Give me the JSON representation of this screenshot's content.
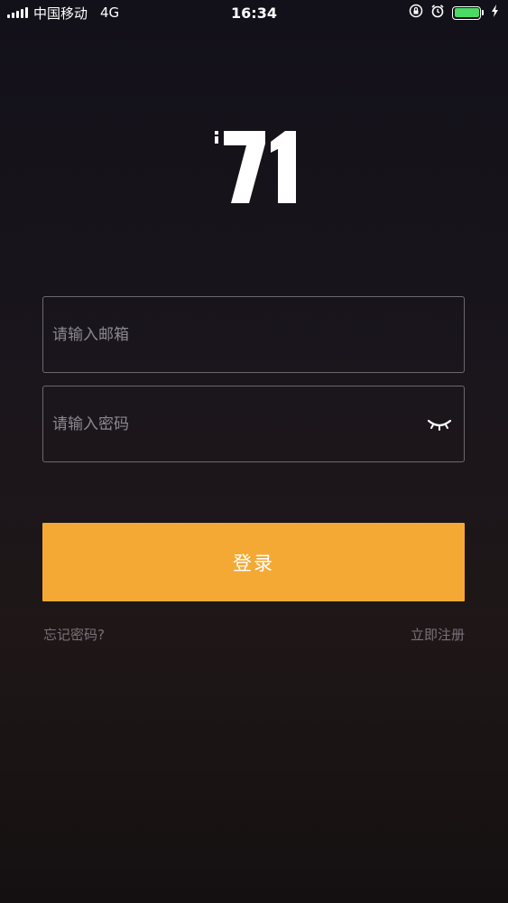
{
  "status_bar": {
    "carrier": "中国移动",
    "network": "4G",
    "time": "16:34"
  },
  "logo": {
    "text": "71",
    "small_mark": "i"
  },
  "login_form": {
    "email_placeholder": "请输入邮箱",
    "email_value": "",
    "password_placeholder": "请输入密码",
    "password_value": "",
    "password_toggle_icon": "eye-closed-icon",
    "login_label": "登录",
    "forgot_label": "忘记密码?",
    "register_label": "立即注册"
  },
  "colors": {
    "accent": "#f4a935",
    "battery": "#4cd964",
    "border": "#6c6870",
    "muted_text": "#77727a"
  }
}
